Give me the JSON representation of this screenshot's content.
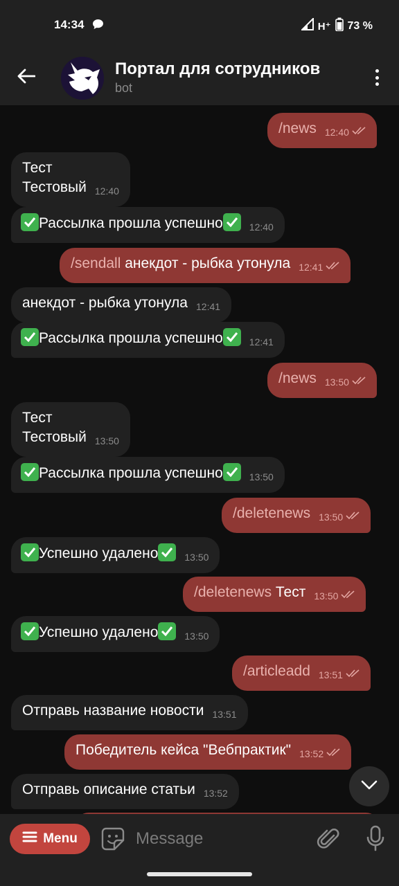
{
  "status": {
    "time": "14:34",
    "network": "H⁺",
    "battery": "73 %"
  },
  "header": {
    "title": "Портал для сотрудников",
    "subtitle": "bot"
  },
  "messages": [
    {
      "dir": "out",
      "cmd": "/news",
      "text": "",
      "time": "12:40"
    },
    {
      "dir": "in",
      "lines": [
        "Тест",
        "Тестовый"
      ],
      "time": "12:40"
    },
    {
      "dir": "in",
      "text": "Рассылка прошла успешно",
      "check": true,
      "time": "12:40"
    },
    {
      "dir": "out",
      "cmd": "/sendall",
      "text": " анекдот - рыбка утонула",
      "time": "12:41"
    },
    {
      "dir": "in",
      "text": "анекдот - рыбка утонула",
      "time": "12:41"
    },
    {
      "dir": "in",
      "text": "Рассылка прошла успешно",
      "check": true,
      "time": "12:41"
    },
    {
      "dir": "out",
      "cmd": "/news",
      "text": "",
      "time": "13:50"
    },
    {
      "dir": "in",
      "lines": [
        "Тест",
        "Тестовый"
      ],
      "time": "13:50"
    },
    {
      "dir": "in",
      "text": "Рассылка прошла успешно",
      "check": true,
      "time": "13:50"
    },
    {
      "dir": "out",
      "cmd": "/deletenews",
      "text": "",
      "time": "13:50"
    },
    {
      "dir": "in",
      "text": "Успешно удалено",
      "check": true,
      "time": "13:50"
    },
    {
      "dir": "out",
      "cmd": "/deletenews",
      "text": " Тест",
      "time": "13:50"
    },
    {
      "dir": "in",
      "text": "Успешно удалено",
      "check": true,
      "time": "13:50"
    },
    {
      "dir": "out",
      "cmd": "/articleadd",
      "text": "",
      "time": "13:51"
    },
    {
      "dir": "in",
      "text": "Отправь название новости",
      "time": "13:51"
    },
    {
      "dir": "out",
      "cmd": "",
      "text": "Победитель кейса \"Вебпрактик\"",
      "time": "13:52"
    },
    {
      "dir": "in",
      "text": "Отправь описание статьи",
      "time": "13:52"
    }
  ],
  "input": {
    "menu_label": "Menu",
    "placeholder": "Message"
  },
  "icons": {
    "back": "arrow-left-icon",
    "more": "more-vertical-icon",
    "scroll": "chevron-down-icon",
    "sticker": "sticker-icon",
    "attach": "paperclip-icon",
    "mic": "microphone-icon"
  },
  "colors": {
    "outgoing": "#8f3834",
    "incoming": "#212121",
    "menu_button": "#c2453e",
    "command": "#e9b1ad"
  }
}
